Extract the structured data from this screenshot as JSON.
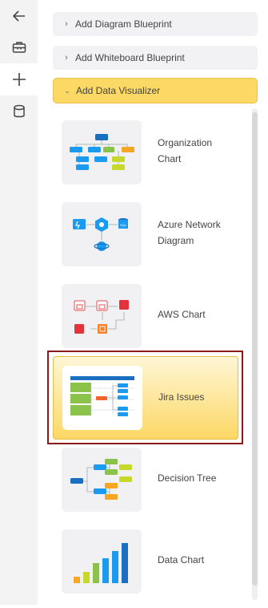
{
  "rail": {
    "buttons": [
      {
        "name": "back-arrow-icon"
      },
      {
        "name": "toolbox-icon"
      },
      {
        "name": "plus-icon"
      },
      {
        "name": "database-icon"
      }
    ]
  },
  "accordion": {
    "sections": [
      {
        "label": "Add Diagram Blueprint",
        "state": "collapsed"
      },
      {
        "label": "Add Whiteboard Blueprint",
        "state": "collapsed"
      },
      {
        "label": "Add Data Visualizer",
        "state": "expanded"
      }
    ]
  },
  "visualizers": [
    {
      "label": "Organization Chart",
      "selected": false
    },
    {
      "label": "Azure Network Diagram",
      "selected": false
    },
    {
      "label": "AWS Chart",
      "selected": false
    },
    {
      "label": "Jira Issues",
      "selected": true
    },
    {
      "label": "Decision Tree",
      "selected": false
    },
    {
      "label": "Data Chart",
      "selected": false
    }
  ],
  "colors": {
    "accent_yellow": "#fcd865",
    "selection_outline": "#8b1a1a",
    "blue": "#1a9bf0",
    "green": "#8bc34a",
    "lime": "#c6d82a",
    "orange": "#f5a623"
  }
}
